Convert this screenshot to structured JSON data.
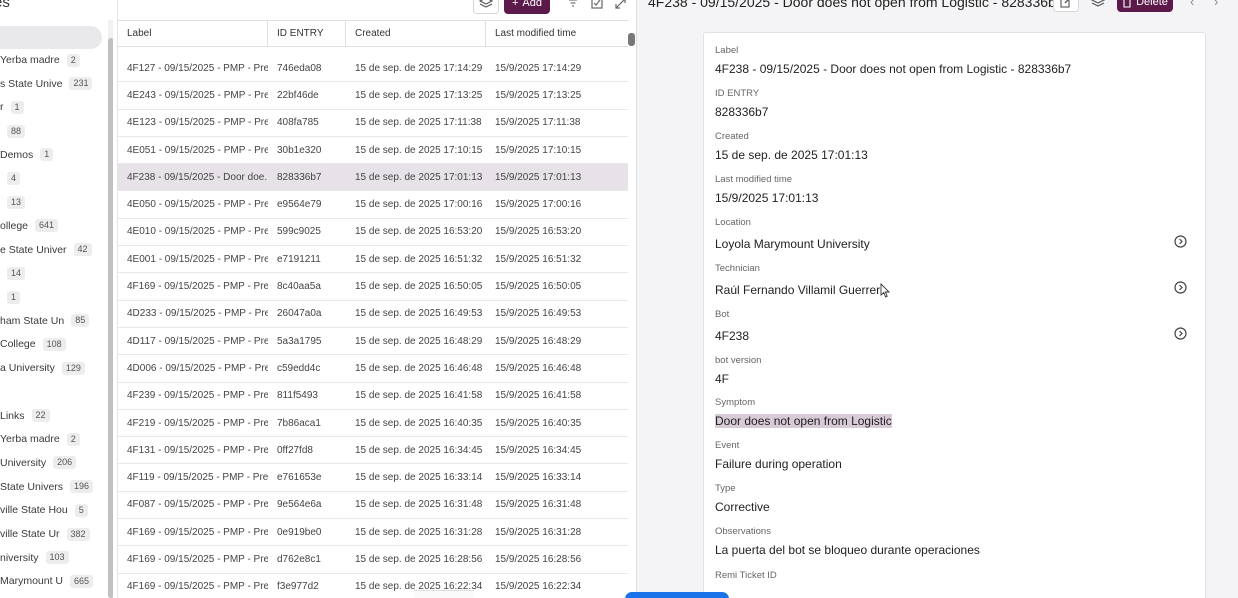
{
  "left_panel": {
    "header": "es",
    "groups": [
      {
        "name": "Yerba madre",
        "count": "2"
      },
      {
        "name": "s State Unive",
        "count": "231"
      },
      {
        "name": "r",
        "count": "1"
      },
      {
        "name": "",
        "count": "88"
      },
      {
        "name": "Demos",
        "count": "1"
      },
      {
        "name": "",
        "count": "4"
      },
      {
        "name": "",
        "count": "13"
      },
      {
        "name": "ollege",
        "count": "641"
      },
      {
        "name": "e State Univer",
        "count": "42"
      },
      {
        "name": "",
        "count": "14"
      },
      {
        "name": "",
        "count": "1"
      },
      {
        "name": "ham State Un",
        "count": "85"
      },
      {
        "name": "College",
        "count": "108"
      },
      {
        "name": "a University",
        "count": "129"
      },
      {
        "name": "",
        "count": ""
      },
      {
        "name": "Links",
        "count": "22"
      },
      {
        "name": "Yerba madre",
        "count": "2"
      },
      {
        "name": "University",
        "count": "206"
      },
      {
        "name": "State Univers",
        "count": "196"
      },
      {
        "name": "ville State Hou",
        "count": "5"
      },
      {
        "name": "ville State Ur",
        "count": "382"
      },
      {
        "name": "niversity",
        "count": "103"
      },
      {
        "name": "Marymount U",
        "count": "665"
      }
    ]
  },
  "toolbar": {
    "add_label": "Add"
  },
  "table": {
    "columns": [
      "Label",
      "ID ENTRY",
      "Created",
      "Last modified time"
    ],
    "rows": [
      {
        "label": "4F127 - 09/15/2025 - PMP - Pre...",
        "id": "746eda08",
        "created": "15 de sep. de 2025 17:14:29",
        "modified": "15/9/2025 17:14:29"
      },
      {
        "label": "4E243 - 09/15/2025 - PMP - Pre...",
        "id": "22bf46de",
        "created": "15 de sep. de 2025 17:13:25",
        "modified": "15/9/2025 17:13:25"
      },
      {
        "label": "4E123 - 09/15/2025 - PMP - Pre...",
        "id": "408fa785",
        "created": "15 de sep. de 2025 17:11:38",
        "modified": "15/9/2025 17:11:38"
      },
      {
        "label": "4E051 - 09/15/2025 - PMP - Pre...",
        "id": "30b1e320",
        "created": "15 de sep. de 2025 17:10:15",
        "modified": "15/9/2025 17:10:15"
      },
      {
        "label": "4F238 - 09/15/2025 - Door doe...",
        "id": "828336b7",
        "created": "15 de sep. de 2025 17:01:13",
        "modified": "15/9/2025 17:01:13"
      },
      {
        "label": "4E050 - 09/15/2025 - PMP - Pre...",
        "id": "e9564e79",
        "created": "15 de sep. de 2025 17:00:16",
        "modified": "15/9/2025 17:00:16"
      },
      {
        "label": "4E010 - 09/15/2025 - PMP - Pre...",
        "id": "599c9025",
        "created": "15 de sep. de 2025 16:53:20",
        "modified": "15/9/2025 16:53:20"
      },
      {
        "label": "4E001 - 09/15/2025 - PMP - Pre...",
        "id": "e7191211",
        "created": "15 de sep. de 2025 16:51:32",
        "modified": "15/9/2025 16:51:32"
      },
      {
        "label": "4F169 - 09/15/2025 - PMP - Pre...",
        "id": "8c40aa5a",
        "created": "15 de sep. de 2025 16:50:05",
        "modified": "15/9/2025 16:50:05"
      },
      {
        "label": "4D233 - 09/15/2025 - PMP - Pre...",
        "id": "26047a0a",
        "created": "15 de sep. de 2025 16:49:53",
        "modified": "15/9/2025 16:49:53"
      },
      {
        "label": "4D117 - 09/15/2025 - PMP - Pre...",
        "id": "5a3a1795",
        "created": "15 de sep. de 2025 16:48:29",
        "modified": "15/9/2025 16:48:29"
      },
      {
        "label": "4D006 - 09/15/2025 - PMP - Pre...",
        "id": "c59edd4c",
        "created": "15 de sep. de 2025 16:46:48",
        "modified": "15/9/2025 16:46:48"
      },
      {
        "label": "4F239 - 09/15/2025 - PMP - Pre...",
        "id": "811f5493",
        "created": "15 de sep. de 2025 16:41:58",
        "modified": "15/9/2025 16:41:58"
      },
      {
        "label": "4F219 - 09/15/2025 - PMP - Pre...",
        "id": "7b86aca1",
        "created": "15 de sep. de 2025 16:40:35",
        "modified": "15/9/2025 16:40:35"
      },
      {
        "label": "4F131 - 09/15/2025 - PMP - Pre...",
        "id": "0ff27fd8",
        "created": "15 de sep. de 2025 16:34:45",
        "modified": "15/9/2025 16:34:45"
      },
      {
        "label": "4F119 - 09/15/2025 - PMP - Pre...",
        "id": "e761653e",
        "created": "15 de sep. de 2025 16:33:14",
        "modified": "15/9/2025 16:33:14"
      },
      {
        "label": "4F087 - 09/15/2025 - PMP - Pre...",
        "id": "9e564e6a",
        "created": "15 de sep. de 2025 16:31:48",
        "modified": "15/9/2025 16:31:48"
      },
      {
        "label": "4F169 - 09/15/2025 - PMP - Pre...",
        "id": "0e919be0",
        "created": "15 de sep. de 2025 16:31:28",
        "modified": "15/9/2025 16:31:28"
      },
      {
        "label": "4F169 - 09/15/2025 - PMP - Pre...",
        "id": "d762e8c1",
        "created": "15 de sep. de 2025 16:28:56",
        "modified": "15/9/2025 16:28:56"
      },
      {
        "label": "4F169 - 09/15/2025 - PMP - Pre...",
        "id": "f3e977d2",
        "created": "15 de sep. de 2025 16:22:34",
        "modified": "15/9/2025 16:22:34"
      }
    ],
    "selected_index": 4
  },
  "detail": {
    "title": "4F238 - 09/15/2025 - Door does not open from Logistic - 828336b7",
    "delete_label": "Delete",
    "fields": [
      {
        "label": "Label",
        "value": "4F238 - 09/15/2025 - Door does not open from Logistic - 828336b7"
      },
      {
        "label": "ID ENTRY",
        "value": "828336b7"
      },
      {
        "label": "Created",
        "value": "15 de sep. de 2025 17:01:13"
      },
      {
        "label": "Last modified time",
        "value": "15/9/2025 17:01:13"
      },
      {
        "label": "Location",
        "value": "Loyola Marymount University"
      },
      {
        "label": "Technician",
        "value": "Raúl Fernando Villamil Guerrero"
      },
      {
        "label": "Bot",
        "value": "4F238"
      },
      {
        "label": "bot version",
        "value": "4F"
      },
      {
        "label": "Symptom",
        "value": "Door does not open from Logistic"
      },
      {
        "label": "Event",
        "value": "Failure during operation"
      },
      {
        "label": "Type",
        "value": "Corrective"
      },
      {
        "label": "Observations",
        "value": "La puerta del bot se bloqueo durante operaciones"
      },
      {
        "label": "Remi Ticket ID",
        "value": ""
      }
    ]
  },
  "colors": {
    "brand": "#5b1a4a",
    "selected_row": "#e6e2e8",
    "highlight": "#d8cbd7"
  }
}
